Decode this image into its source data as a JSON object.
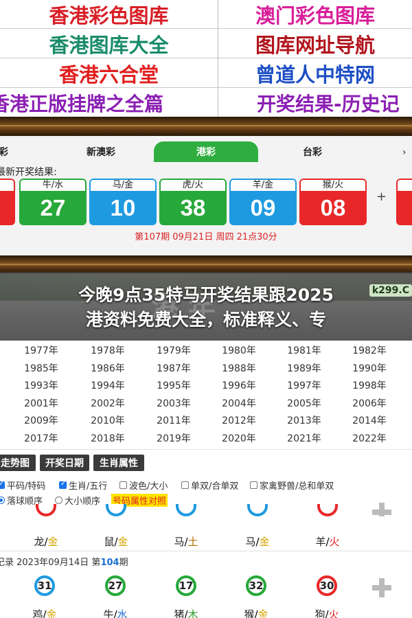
{
  "links": [
    {
      "text": "香港彩色图库",
      "color": "#d81f26"
    },
    {
      "text": "澳门彩色图库",
      "color": "#d81f9a"
    },
    {
      "text": "香港图库大全",
      "color": "#1a8c6a"
    },
    {
      "text": "图库网址导航",
      "color": "#b2151d"
    },
    {
      "text": "香港六合堂",
      "color": "#e0201f"
    },
    {
      "text": "曾道人中特网",
      "color": "#1d4fc4"
    },
    {
      "text": "香港正版挂牌之全篇",
      "color": "#8b1fb3"
    },
    {
      "text": "开奖结果-历史记",
      "color": "#8b1fb3"
    }
  ],
  "tabs": [
    "彩",
    "新澳彩",
    "港彩",
    "台彩"
  ],
  "latest_label": "最新开奖结果:",
  "balls": [
    {
      "zodiac": "牛/水",
      "number": "27",
      "color": "green"
    },
    {
      "zodiac": "马/金",
      "number": "10",
      "color": "blue"
    },
    {
      "zodiac": "虎/火",
      "number": "38",
      "color": "green"
    },
    {
      "zodiac": "羊/金",
      "number": "09",
      "color": "blue"
    },
    {
      "zodiac": "猴/火",
      "number": "08",
      "color": "red"
    }
  ],
  "plus": "+",
  "issue_info": "第107期 09月21日 周四 21点30分",
  "headline": {
    "line1": "今晚9点35特马开奖结果跟2025",
    "line2": "港资料免费大全，标准释义、专",
    "bg_text": "港   年",
    "site_tag": "k299.C"
  },
  "years": [
    [
      "1977年",
      "1978年",
      "1979年",
      "1980年",
      "1981年",
      "1982年"
    ],
    [
      "1985年",
      "1986年",
      "1987年",
      "1988年",
      "1989年",
      "1990年"
    ],
    [
      "1993年",
      "1994年",
      "1995年",
      "1996年",
      "1997年",
      "1998年"
    ],
    [
      "2001年",
      "2002年",
      "2003年",
      "2004年",
      "2005年",
      "2006年"
    ],
    [
      "2009年",
      "2010年",
      "2011年",
      "2012年",
      "2013年",
      "2014年"
    ],
    [
      "2017年",
      "2018年",
      "2019年",
      "2020年",
      "2021年",
      "2022年"
    ]
  ],
  "buttons": [
    "走势图",
    "开奖日期",
    "生肖属性"
  ],
  "filters_row1": [
    {
      "label": "平码/特码",
      "checked": true
    },
    {
      "label": "生肖/五行",
      "checked": true
    },
    {
      "label": "波色/大小",
      "checked": false
    },
    {
      "label": "单双/合单双",
      "checked": false
    },
    {
      "label": "家禽野兽/总和单双",
      "checked": false
    }
  ],
  "filters_row2": [
    {
      "label": "落球顺序",
      "checked": true
    },
    {
      "label": "大小顺序",
      "checked": false
    }
  ],
  "highlight_label": "号码属性对照",
  "history_row1": [
    {
      "zodiac": "龙",
      "element": "金",
      "el": "gold"
    },
    {
      "zodiac": "鼠",
      "element": "金",
      "el": "gold"
    },
    {
      "zodiac": "马",
      "element": "土",
      "el": "earth"
    },
    {
      "zodiac": "马",
      "element": "金",
      "el": "gold"
    },
    {
      "zodiac": "羊",
      "element": "火",
      "el": "fire"
    }
  ],
  "record": {
    "prefix": "记录 2023年09月14日 第",
    "issue": "104",
    "suffix": "期"
  },
  "history_row2_balls": [
    {
      "number": "31",
      "color": "blue"
    },
    {
      "number": "27",
      "color": "green"
    },
    {
      "number": "17",
      "color": "green"
    },
    {
      "number": "32",
      "color": "green"
    },
    {
      "number": "30",
      "color": "red"
    }
  ],
  "history_row2_zodiac": [
    {
      "zodiac": "鸡",
      "element": "金",
      "el": "gold"
    },
    {
      "zodiac": "牛",
      "element": "水",
      "el": "water"
    },
    {
      "zodiac": "猪",
      "element": "木",
      "el": "wood"
    },
    {
      "zodiac": "猴",
      "element": "金",
      "el": "gold"
    },
    {
      "zodiac": "狗",
      "element": "火",
      "el": "fire"
    }
  ]
}
